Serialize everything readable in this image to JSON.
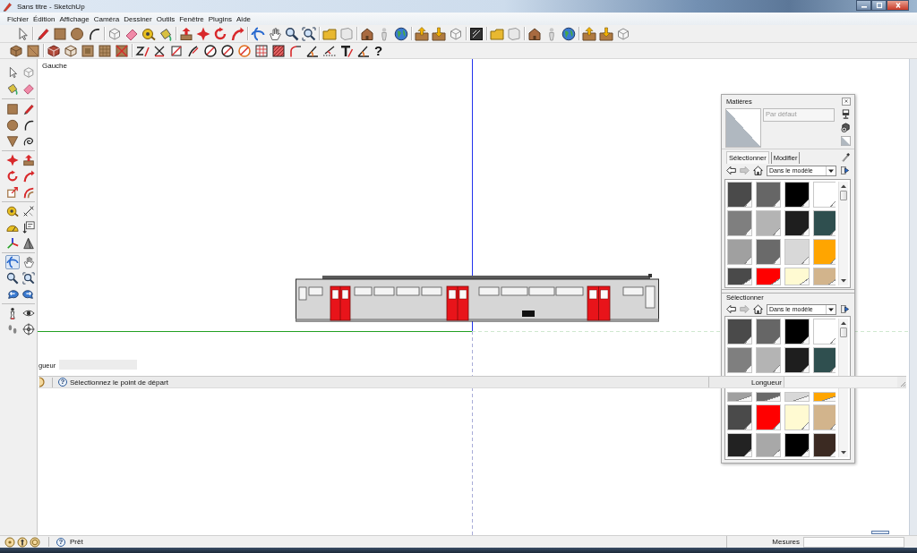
{
  "window": {
    "title": "Sans titre - SketchUp"
  },
  "menu": [
    "Fichier",
    "Édition",
    "Affichage",
    "Caméra",
    "Dessiner",
    "Outils",
    "Fenêtre",
    "Plugins",
    "Aide"
  ],
  "toolbar": {
    "help": "?"
  },
  "tool_palette": [
    [
      {
        "kind": "select",
        "selected": false
      },
      {
        "kind": "component",
        "selected": false
      },
      {
        "kind": "paint",
        "selected": false
      },
      {
        "kind": "eraser",
        "selected": false
      }
    ],
    [
      {
        "kind": "rectangle",
        "selected": false
      },
      {
        "kind": "line",
        "selected": false
      },
      {
        "kind": "circle",
        "selected": false
      },
      {
        "kind": "arc",
        "selected": false
      },
      {
        "kind": "polygon",
        "selected": false
      },
      {
        "kind": "freehand",
        "selected": false
      }
    ],
    [
      {
        "kind": "move",
        "selected": false
      },
      {
        "kind": "pushpull",
        "selected": false
      },
      {
        "kind": "rotate",
        "selected": false
      },
      {
        "kind": "followme",
        "selected": false
      },
      {
        "kind": "scale",
        "selected": false
      },
      {
        "kind": "offset",
        "selected": false
      }
    ],
    [
      {
        "kind": "tape",
        "selected": false
      },
      {
        "kind": "dimension",
        "selected": false
      },
      {
        "kind": "protractor",
        "selected": false
      },
      {
        "kind": "section",
        "selected": false
      },
      {
        "kind": "axes",
        "selected": false
      },
      {
        "kind": "text3d",
        "selected": false
      }
    ],
    [
      {
        "kind": "orbit",
        "selected": true
      },
      {
        "kind": "pan",
        "selected": false
      },
      {
        "kind": "zoom",
        "selected": false
      },
      {
        "kind": "zoomextents",
        "selected": false
      },
      {
        "kind": "previous",
        "selected": false
      },
      {
        "kind": "next",
        "selected": false
      }
    ],
    [
      {
        "kind": "walk",
        "selected": false
      },
      {
        "kind": "lookaround",
        "selected": false
      },
      {
        "kind": "footprints",
        "selected": false
      },
      {
        "kind": "camera",
        "selected": false
      }
    ]
  ],
  "viewport": {
    "view_label": "Gauche",
    "length_label": "gueur",
    "hint_bar": {
      "help": "?",
      "message": "Sélectionnez le point de départ",
      "length_label": "Longueur"
    }
  },
  "materials_panel": {
    "title": "Matières",
    "name_field": {
      "value": "Par défaut",
      "disabled": true
    },
    "tabs": [
      {
        "label": "Sélectionner",
        "selected": true
      },
      {
        "label": "Modifier",
        "selected": false
      }
    ],
    "history": [
      {
        "kind": "back",
        "disabled": false
      },
      {
        "kind": "forward",
        "disabled": true
      }
    ],
    "library": "Dans le modèle",
    "swatches": [
      {
        "color": "#4a4a4a"
      },
      {
        "color": "#666666"
      },
      {
        "color": "#000000"
      },
      {
        "color": "#ffffff"
      },
      {
        "color": "#7f7f7f"
      },
      {
        "color": "#b4b4b4"
      },
      {
        "color": "#1e1e1e"
      },
      {
        "color": "#2f4f4f"
      },
      {
        "color": "#a0a0a0"
      },
      {
        "color": "#6a6a6a"
      },
      {
        "color": "#d8d8d8"
      },
      {
        "color": "#ffa500"
      },
      {
        "color": "#4a4a4a"
      },
      {
        "color": "#ff0000"
      },
      {
        "color": "#fffad2"
      },
      {
        "color": "#d2b48c"
      }
    ],
    "secondary": {
      "title": "Sélectionner",
      "history": [
        {
          "kind": "back",
          "disabled": false
        },
        {
          "kind": "forward",
          "disabled": true
        }
      ],
      "library": "Dans le modèle",
      "swatches": [
        {
          "color": "#4a4a4a"
        },
        {
          "color": "#666666"
        },
        {
          "color": "#000000"
        },
        {
          "color": "#ffffff"
        },
        {
          "color": "#7f7f7f"
        },
        {
          "color": "#b4b4b4"
        },
        {
          "color": "#1e1e1e"
        },
        {
          "color": "#2f4f4f"
        },
        {
          "color": "#a0a0a0"
        },
        {
          "color": "#6a6a6a"
        },
        {
          "color": "#d8d8d8"
        },
        {
          "color": "#ffa500"
        },
        {
          "color": "#4a4a4a"
        },
        {
          "color": "#ff0000"
        },
        {
          "color": "#fffad2"
        },
        {
          "color": "#d2b48c"
        },
        {
          "color": "#222222"
        },
        {
          "color": "#a8a8a8"
        },
        {
          "color": "#000000"
        },
        {
          "color": "#3b2a22"
        }
      ]
    }
  },
  "status_bar": {
    "help": "?",
    "message": "Prêt",
    "measurements_label": "Mesures"
  }
}
